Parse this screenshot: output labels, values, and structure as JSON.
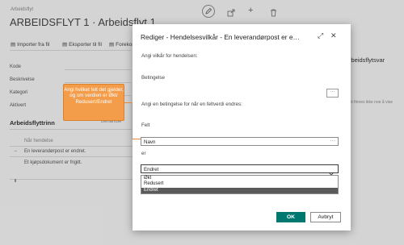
{
  "background": {
    "breadcrumb": "Arbeidsflyt",
    "page_title": "ARBEIDSFLYT 1 · Arbeidsflyt 1",
    "actions": [
      "Importer fra fil",
      "Eksporter til fil",
      "Forekomste"
    ],
    "fields": [
      "Kode",
      "Beskrivelse",
      "Kategori",
      "Aktivert"
    ],
    "section_title": "Arbeidsflyttrinn",
    "section_tab": "Behandle",
    "column_header": "Når hendelse",
    "rows": [
      "En leverandørpost er endret.",
      "Et kjøpsdokument er frigitt."
    ],
    "right_panel_title": "Arbeidsflytsvar",
    "right_panel_text": "Det finnes ikke noe å vise"
  },
  "dialog": {
    "title": "Rediger - Hendelsesvilkår - En leverandørpost er e…",
    "intro": "Angi vilkår for hendelsen:",
    "condition_label": "Betingelse",
    "field_change_text": "Angi en betingelse for når en feltverdi endres:",
    "field_label": "Felt",
    "field_value": "Navn",
    "is_label": "er",
    "select_value": "Endret",
    "options": [
      "Økt",
      "Redusert",
      "Endret"
    ],
    "selected_option": "Endret",
    "ok_label": "OK",
    "cancel_label": "Avbryt",
    "expand_icon": "⤢",
    "close_icon": "✕"
  },
  "callout": {
    "text": "Angi hvilket felt det gjelder, og om verdien er Økt/ Redusert/Endret"
  },
  "colors": {
    "ok_button": "#00776f",
    "callout": "#f39c4a",
    "selected_option": "#5a5a5a"
  }
}
